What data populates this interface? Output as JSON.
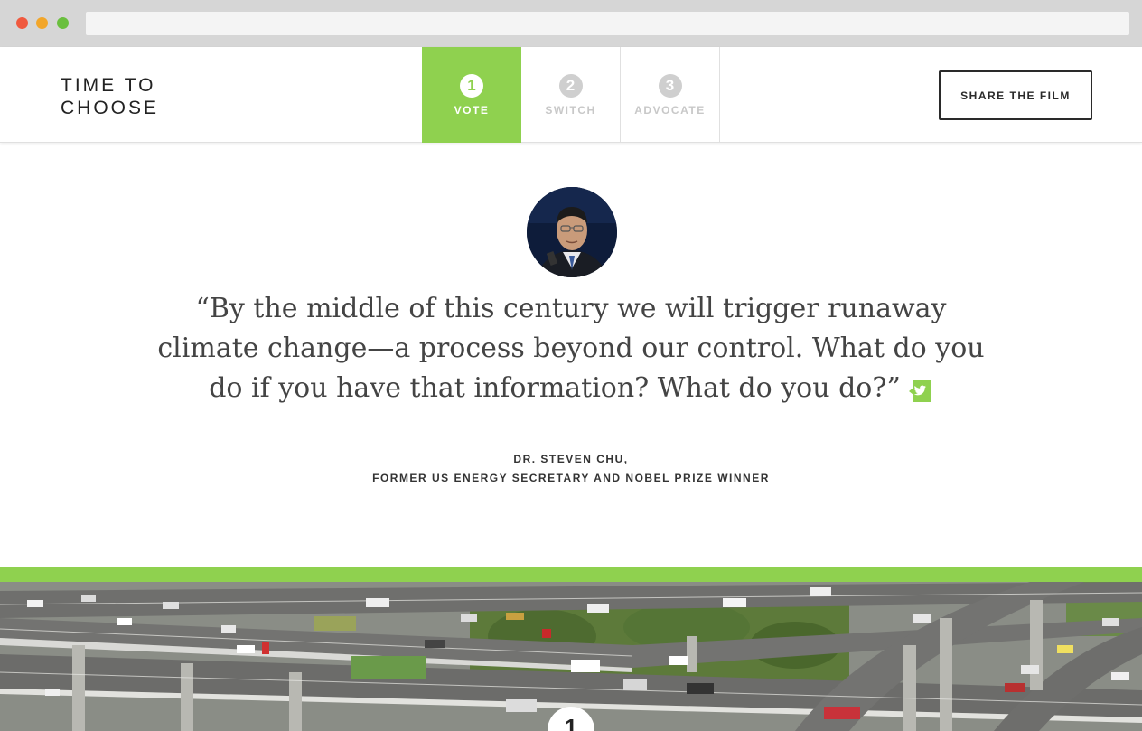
{
  "browser": {
    "dots": [
      "close",
      "minimize",
      "maximize"
    ],
    "url": ""
  },
  "header": {
    "logo_line1": "TIME TO",
    "logo_line2": "CHOOSE",
    "steps": [
      {
        "number": "1",
        "label": "VOTE",
        "active": true
      },
      {
        "number": "2",
        "label": "SWITCH",
        "active": false
      },
      {
        "number": "3",
        "label": "ADVOCATE",
        "active": false
      }
    ],
    "share_label": "SHARE THE FILM"
  },
  "quote": {
    "text": "“By the middle of this century we will trigger runaway climate change—a process beyond our control. What do you do if you have that information? What do you do?”",
    "author_name": "DR. STEVEN CHU,",
    "author_title": "FORMER US ENERGY SECRETARY AND NOBEL PRIZE WINNER",
    "share_icon": "twitter-icon"
  },
  "hero": {
    "badge_number": "1"
  },
  "colors": {
    "accent": "#8fd14f",
    "text": "#444444",
    "chrome": "#d6d6d6"
  }
}
